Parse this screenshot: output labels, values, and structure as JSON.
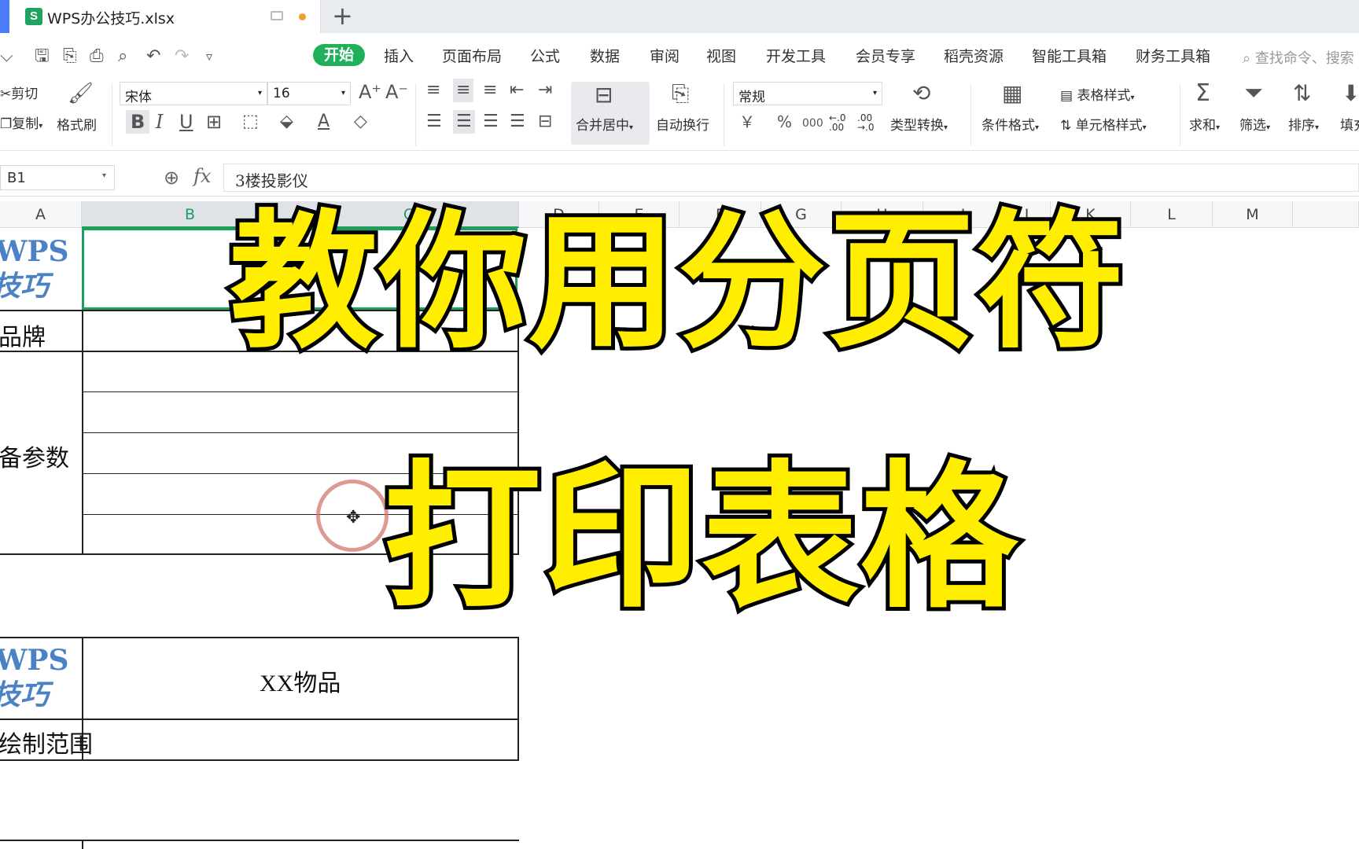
{
  "titlebar": {
    "tab_title": "WPS办公技巧.xlsx",
    "app_icon": "S",
    "new_tab": "+"
  },
  "menu": {
    "items": [
      "开始",
      "插入",
      "页面布局",
      "公式",
      "数据",
      "审阅",
      "视图",
      "开发工具",
      "会员专享",
      "稻壳资源",
      "智能工具箱",
      "财务工具箱"
    ],
    "active": "开始",
    "search": "查找命令、搜索"
  },
  "ribbon": {
    "cut": "剪切",
    "copy": "复制",
    "format_painter": "格式刷",
    "font_name": "宋体",
    "font_size": "16",
    "number_format": "常规",
    "merge_center": "合并居中",
    "wrap_text": "自动换行",
    "type_convert": "类型转换",
    "conditional_format": "条件格式",
    "table_style": "表格样式",
    "cell_style": "单元格样式",
    "sum": "求和",
    "filter": "筛选",
    "sort": "排序",
    "fill": "填充",
    "currency_symbol": "￥",
    "percent_symbol": "%",
    "thousands_symbol": "000",
    "inc_decimal": "←.0 .00",
    "dec_decimal": ".00 →.0"
  },
  "formula_bar": {
    "name_box": "B1",
    "fx": "fx",
    "content": "3楼投影仪"
  },
  "columns": [
    "A",
    "B",
    "C",
    "D",
    "E",
    "F",
    "G",
    "H",
    "I",
    "J",
    "K",
    "L",
    "M"
  ],
  "sheet": {
    "logo_line1": "WPS",
    "logo_line2": "技巧",
    "a2": "品牌",
    "a3": "设备参数",
    "b8": "XX物品",
    "a9": "绘制范围"
  },
  "overlay": {
    "line1": "教你用分页符",
    "line2": "打印表格"
  }
}
